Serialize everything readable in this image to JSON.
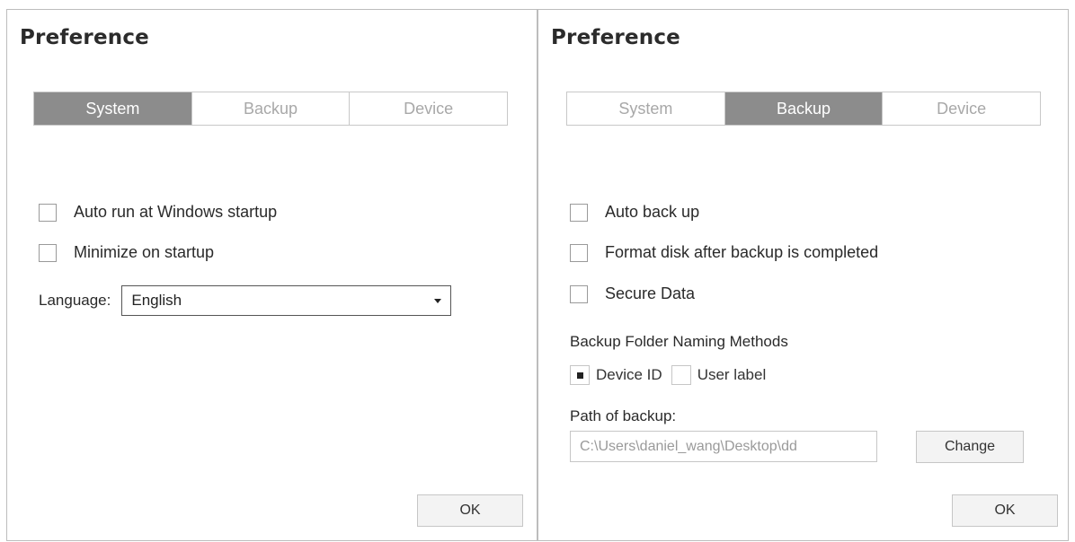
{
  "left_dialog": {
    "title": "Preference",
    "tabs": [
      {
        "label": "System",
        "active": true
      },
      {
        "label": "Backup",
        "active": false
      },
      {
        "label": "Device",
        "active": false
      }
    ],
    "options": [
      {
        "label": "Auto run at Windows startup",
        "checked": false
      },
      {
        "label": "Minimize on startup",
        "checked": false
      }
    ],
    "language": {
      "label": "Language:",
      "value": "English"
    },
    "ok_label": "OK"
  },
  "right_dialog": {
    "title": "Preference",
    "tabs": [
      {
        "label": "System",
        "active": false
      },
      {
        "label": "Backup",
        "active": true
      },
      {
        "label": "Device",
        "active": false
      }
    ],
    "options": [
      {
        "label": "Auto back up",
        "checked": false
      },
      {
        "label": "Format disk after backup is completed",
        "checked": false
      },
      {
        "label": "Secure Data",
        "checked": false
      }
    ],
    "naming": {
      "label": "Backup Folder Naming Methods",
      "choices": [
        {
          "label": "Device ID",
          "selected": true
        },
        {
          "label": "User label",
          "selected": false
        }
      ]
    },
    "path": {
      "label": "Path of backup:",
      "value": "C:\\Users\\daniel_wang\\Desktop\\dd"
    },
    "change_label": "Change",
    "ok_label": "OK"
  },
  "colors": {
    "active_tab_bg": "#8c8c8c",
    "inactive_tab_text": "#a8a8a8",
    "border": "#bdbdbd"
  }
}
